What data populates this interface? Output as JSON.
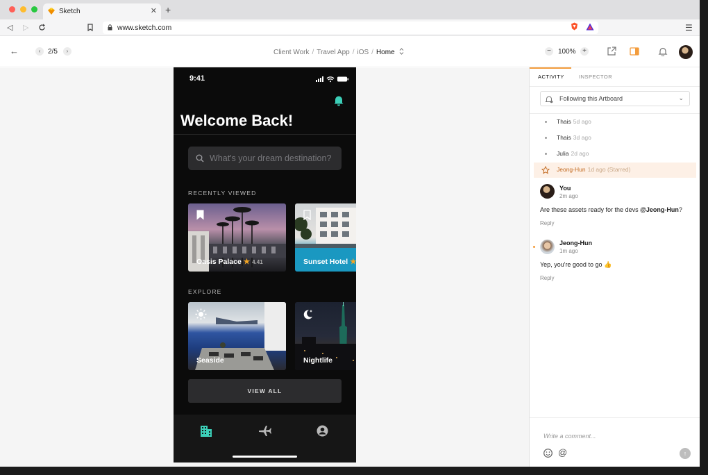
{
  "browser": {
    "tab_title": "Sketch",
    "url": "www.sketch.com"
  },
  "toolbar": {
    "pager": "2/5",
    "breadcrumb": [
      "Client Work",
      "Travel App",
      "iOS",
      "Home"
    ],
    "zoom": "100%"
  },
  "phone": {
    "time": "9:41",
    "heading": "Welcome Back!",
    "search_placeholder": "What's your dream destination?",
    "recently_viewed_label": "RECENTLY VIEWED",
    "recent": [
      {
        "title": "Oasis Palace",
        "star": "★",
        "rating": "4.41"
      },
      {
        "title": "Sunset Hotel",
        "star": "★"
      }
    ],
    "explore_label": "EXPLORE",
    "explore": [
      {
        "title": "Seaside",
        "icon": "sun-icon"
      },
      {
        "title": "Nightlife",
        "icon": "moon-icon"
      }
    ],
    "view_all": "VIEW ALL",
    "nav": [
      "hotel-icon",
      "plane-icon",
      "profile-icon"
    ]
  },
  "panel": {
    "tabs": [
      "ACTIVITY",
      "INSPECTOR"
    ],
    "follow_label": "Following this Artboard",
    "activity": [
      {
        "name": "Thais",
        "time": "5d ago"
      },
      {
        "name": "Thais",
        "time": "3d ago"
      },
      {
        "name": "Julia",
        "time": "2d ago"
      },
      {
        "name": "Jeong-Hun",
        "time": "1d ago (Starred)"
      }
    ],
    "comments": [
      {
        "name": "You",
        "time": "2m ago",
        "text_pre": "Are these assets ready for the devs ",
        "mention": "@Jeong-Hun",
        "text_post": "?",
        "reply": "Reply"
      },
      {
        "name": "Jeong-Hun",
        "time": "1m ago",
        "text": "Yep, you're good to go 👍",
        "reply": "Reply"
      }
    ],
    "composer_placeholder": "Write a comment...",
    "composer_at": "@"
  },
  "colors": {
    "accent": "#f39c3c",
    "teal": "#3ccfb8",
    "phone_bg": "#0b0b0b"
  }
}
